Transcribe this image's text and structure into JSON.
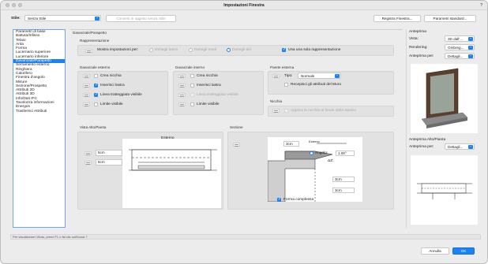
{
  "window": {
    "title": "Impostazioni Finestra",
    "help": "?"
  },
  "top": {
    "stile_label": "Stile:",
    "stile_value": "Senza Stile",
    "convert_button": "Converti in oggetto senza Stile",
    "registra_button": "Registra Finestra...",
    "parametri_button": "Parametri standard..."
  },
  "sidebar": {
    "items": [
      "Parametri di base",
      "Battuta/Infisso",
      "Telaio",
      "Anta",
      "Forma",
      "Lucernario superiore",
      "Lucernario inferiore",
      "Davanzale/Parapetto",
      "Serramento esterno",
      "Ringhiera",
      "Calorifero",
      "Finestra d'angolo",
      "Misure",
      "Sezione/Prospetto",
      "Attributi 2D",
      "Attributi 3D",
      "Info/Dati IFC",
      "Tavolozza informazioni",
      "Energos",
      "Trasferisci Attributi"
    ],
    "selected_index": 7
  },
  "panel": {
    "title": "Davanzale/Parapetto",
    "rappresentazione": {
      "title": "Rappresentazione",
      "mostra_label": "Mostra impostazioni per:",
      "opt1": "Dettagli bassi",
      "opt2": "Dettagli medi",
      "opt3": "Dettagli alti",
      "usa_label": "Usa una sola rappresentazione"
    },
    "esterno": {
      "title": "Davanzale esterno",
      "crea": "Crea nicchia",
      "inserisci": "Inserisci lastra",
      "linea": "Linea tratteggiata visibile",
      "limite": "Limite visibile"
    },
    "interno": {
      "title": "Davanzale interno",
      "crea": "Crea nicchia",
      "inserisci": "Inserisci lastra",
      "linea": "Linea tratteggiata visibile",
      "limite": "Limite visibile"
    },
    "parete": {
      "title": "Parete esterna",
      "tipo_label": "Tipo:",
      "tipo_value": "Normale",
      "recepisci": "Recepisci gli attributi del Muro"
    },
    "nicchia": {
      "title": "Nicchia",
      "applica": "Applica la nicchia al fondo della Spazio"
    },
    "vista": {
      "title": "Vista Alto/Pianta",
      "esterno": "Esterno",
      "v1": "5cm",
      "v2": "5cm"
    },
    "sezione": {
      "title": "Sezione",
      "top": "3cm",
      "esterno": "Esterno",
      "angolo_label": "Angolo:",
      "angolo_value": "1.00°",
      "dz_label": "ΔZ:",
      "v1": "3cm",
      "v2": "3cm",
      "forma": "Forma complessa"
    }
  },
  "right": {
    "anteprima_title": "Anteprima",
    "vista_label": "Vista:",
    "vista_value": "3D dall'...",
    "rendering_label": "Rendering:",
    "rendering_value": "Ombreg...",
    "anteprima_per_label": "Anteprima per:",
    "anteprima_per_value": "Dettagli...",
    "alto_title": "Anteprima Alto/Pianta",
    "alto_per_label": "Anteprima per:",
    "alto_per_value": "Dettagli..."
  },
  "status": "Per visualizzare l'Aiuto, premi F1 o fai clic sull'icona ?",
  "buttons": {
    "cancel": "Annulla",
    "ok": "OK"
  }
}
